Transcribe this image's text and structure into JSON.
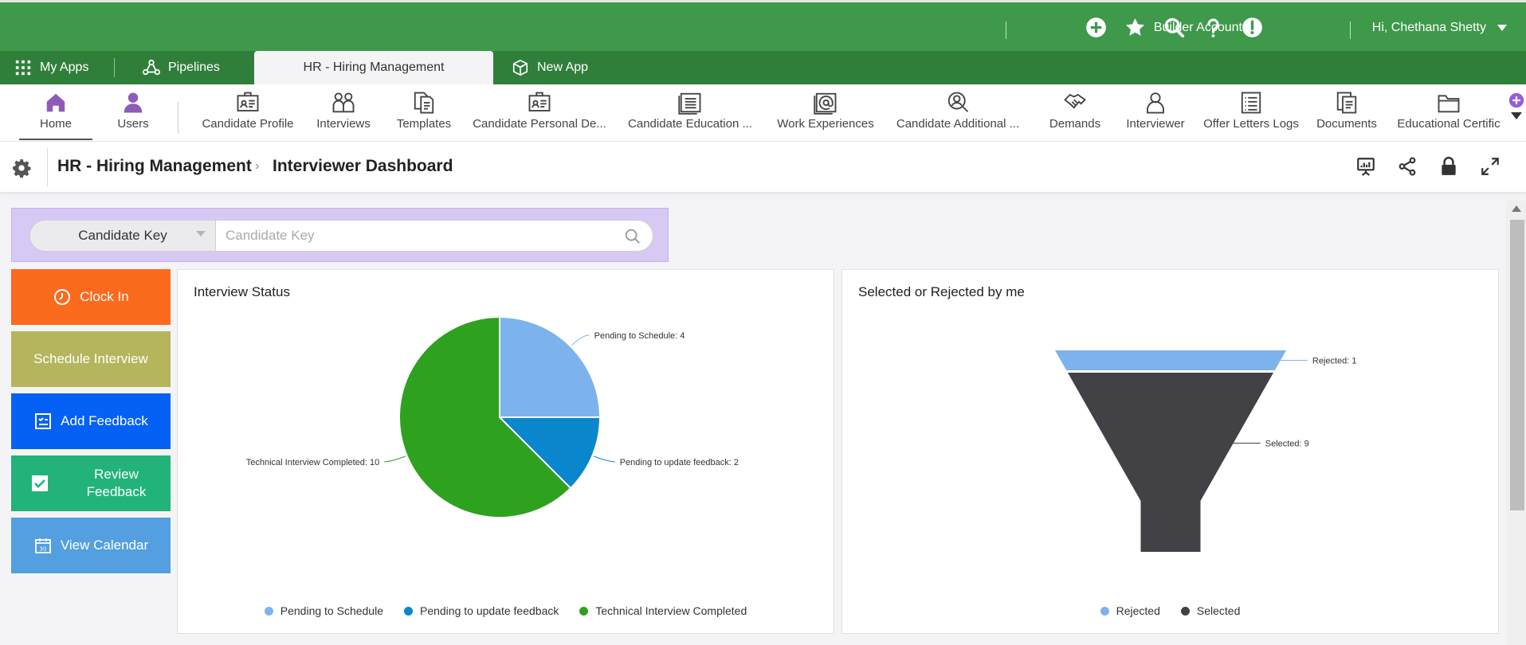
{
  "header": {
    "icons": [
      "add-circle-icon",
      "star-icon",
      "search-icon",
      "help-icon",
      "alert-icon"
    ],
    "account_label": "Builder Account",
    "user_greeting": "Hi, Chethana Shetty"
  },
  "appbar": {
    "my_apps": "My Apps",
    "pipelines": "Pipelines",
    "active_tab": "HR - Hiring Management",
    "new_app": "New App"
  },
  "modules": [
    {
      "label": "Home",
      "icon": "home-icon"
    },
    {
      "label": "Users",
      "icon": "user-icon"
    },
    {
      "label": "Candidate Profile",
      "icon": "id-card-icon"
    },
    {
      "label": "Interviews",
      "icon": "people-icon"
    },
    {
      "label": "Templates",
      "icon": "documents-icon"
    },
    {
      "label": "Candidate Personal De...",
      "icon": "id-card-icon"
    },
    {
      "label": "Candidate Education ...",
      "icon": "list-doc-icon"
    },
    {
      "label": "Work Experiences",
      "icon": "at-doc-icon"
    },
    {
      "label": "Candidate Additional ...",
      "icon": "user-search-icon"
    },
    {
      "label": "Demands",
      "icon": "handshake-icon"
    },
    {
      "label": "Interviewer",
      "icon": "user-outline-icon"
    },
    {
      "label": "Offer Letters Logs",
      "icon": "list-icon"
    },
    {
      "label": "Documents",
      "icon": "documents-icon"
    },
    {
      "label": "Educational Certific",
      "icon": "folder-icon"
    }
  ],
  "breadcrumb": {
    "app": "HR - Hiring Management",
    "page": "Interviewer Dashboard"
  },
  "search": {
    "field_selected": "Candidate Key",
    "placeholder": "Candidate Key"
  },
  "actions": [
    {
      "label": "Clock In",
      "color": "#fb6a1d",
      "icon": "clock-icon"
    },
    {
      "label": "Schedule Interview",
      "color": "#b5b55d",
      "icon": ""
    },
    {
      "label": "Add Feedback",
      "color": "#0561f5",
      "icon": "checklist-icon"
    },
    {
      "label": "Review Feedback",
      "color": "#21b37a",
      "icon": "checkbox-icon"
    },
    {
      "label": "View Calendar",
      "color": "#539fe0",
      "icon": "calendar-icon"
    }
  ],
  "interview_status": {
    "title": "Interview Status"
  },
  "selected_rejected": {
    "title": "Selected or Rejected by me"
  },
  "chart_data": [
    {
      "type": "pie",
      "title": "Interview Status",
      "categories": [
        "Pending to Schedule",
        "Pending to update feedback",
        "Technical Interview Completed"
      ],
      "values": [
        4,
        2,
        10
      ],
      "colors": [
        "#7db3ec",
        "#0a86cc",
        "#2ea11f"
      ],
      "data_labels": [
        "Pending to Schedule: 4",
        "Pending to update feedback: 2",
        "Technical Interview Completed: 10"
      ],
      "legend": "bottom"
    },
    {
      "type": "funnel",
      "title": "Selected or Rejected by me",
      "categories": [
        "Rejected",
        "Selected"
      ],
      "values": [
        1,
        9
      ],
      "colors": [
        "#7db3ec",
        "#424246"
      ],
      "data_labels": [
        "Rejected: 1",
        "Selected: 9"
      ],
      "legend": "bottom"
    }
  ]
}
